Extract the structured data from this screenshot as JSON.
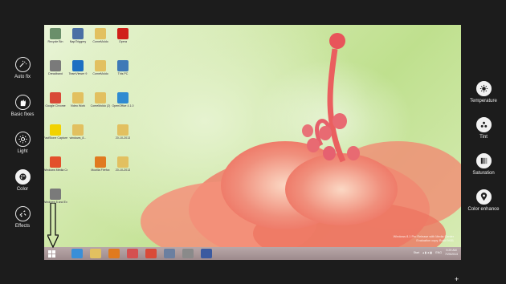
{
  "left_tools": [
    {
      "label": "Auto fix",
      "icon": "auto-fix-icon"
    },
    {
      "label": "Basic fixes",
      "icon": "basic-fixes-icon"
    },
    {
      "label": "Light",
      "icon": "light-icon"
    },
    {
      "label": "Color",
      "icon": "color-icon",
      "selected": true
    },
    {
      "label": "Effects",
      "icon": "effects-icon"
    }
  ],
  "right_tools": [
    {
      "label": "Temperature",
      "icon": "temperature-icon"
    },
    {
      "label": "Tint",
      "icon": "tint-icon"
    },
    {
      "label": "Saturation",
      "icon": "saturation-icon"
    },
    {
      "label": "Color enhance",
      "icon": "color-enhance-icon"
    }
  ],
  "desktop_icons": [
    {
      "label": "Recycle Bin",
      "color": "#6a8f6a"
    },
    {
      "label": "NapiTriggery",
      "color": "#4a6fa5"
    },
    {
      "label": "ComeMoldo",
      "color": "#e2c060"
    },
    {
      "label": "Opera",
      "color": "#d0201a"
    },
    {
      "label": "Dreadband",
      "color": "#7a7a7a"
    },
    {
      "label": "TeamViewer 9",
      "color": "#1d6fc2"
    },
    {
      "label": "ComeMoldo",
      "color": "#e2c060"
    },
    {
      "label": "This PC",
      "color": "#3f79b7"
    },
    {
      "label": "Google Chrome",
      "color": "#d94a38"
    },
    {
      "label": "Video Work",
      "color": "#e2c060"
    },
    {
      "label": "ComeMoldo (2)",
      "color": "#e2c060"
    },
    {
      "label": "OpenOffice 4.1.0",
      "color": "#2f8bd1"
    },
    {
      "label": "FastStone Capture Pro",
      "color": "#f2d200"
    },
    {
      "label": "windows_8...",
      "color": "#e2c060"
    },
    {
      "label": "",
      "color": ""
    },
    {
      "label": "20-10-2013",
      "color": "#e2c060"
    },
    {
      "label": "Windows Media Cent...",
      "color": "#e3502b"
    },
    {
      "label": "",
      "color": ""
    },
    {
      "label": "Mozilla Firefox",
      "color": "#e07a1f"
    },
    {
      "label": "20-10-2013",
      "color": "#e2c060"
    },
    {
      "label": "Windows 8 and Exper...",
      "color": "#7a7a7a"
    }
  ],
  "watermark": {
    "line1": "Windows 8.1 Pro Release with Media Center",
    "line2": "Evaluation copy. Build 9431"
  },
  "taskbar": {
    "apps": [
      {
        "name": "ie-icon",
        "color": "#3a8fd8"
      },
      {
        "name": "file-explorer-icon",
        "color": "#e2c060"
      },
      {
        "name": "firefox-icon",
        "color": "#e07a1f"
      },
      {
        "name": "paint-icon",
        "color": "#d45050"
      },
      {
        "name": "chrome-icon",
        "color": "#d94a38"
      },
      {
        "name": "app-icon",
        "color": "#6b7fa0"
      },
      {
        "name": "app-icon-2",
        "color": "#8a8a8a"
      },
      {
        "name": "word-icon",
        "color": "#3b5aa0"
      }
    ],
    "tray_start": "Start",
    "tray_lang": "ENG",
    "time": "9:29 AM",
    "date": "7/25/2013"
  },
  "plus": "+"
}
